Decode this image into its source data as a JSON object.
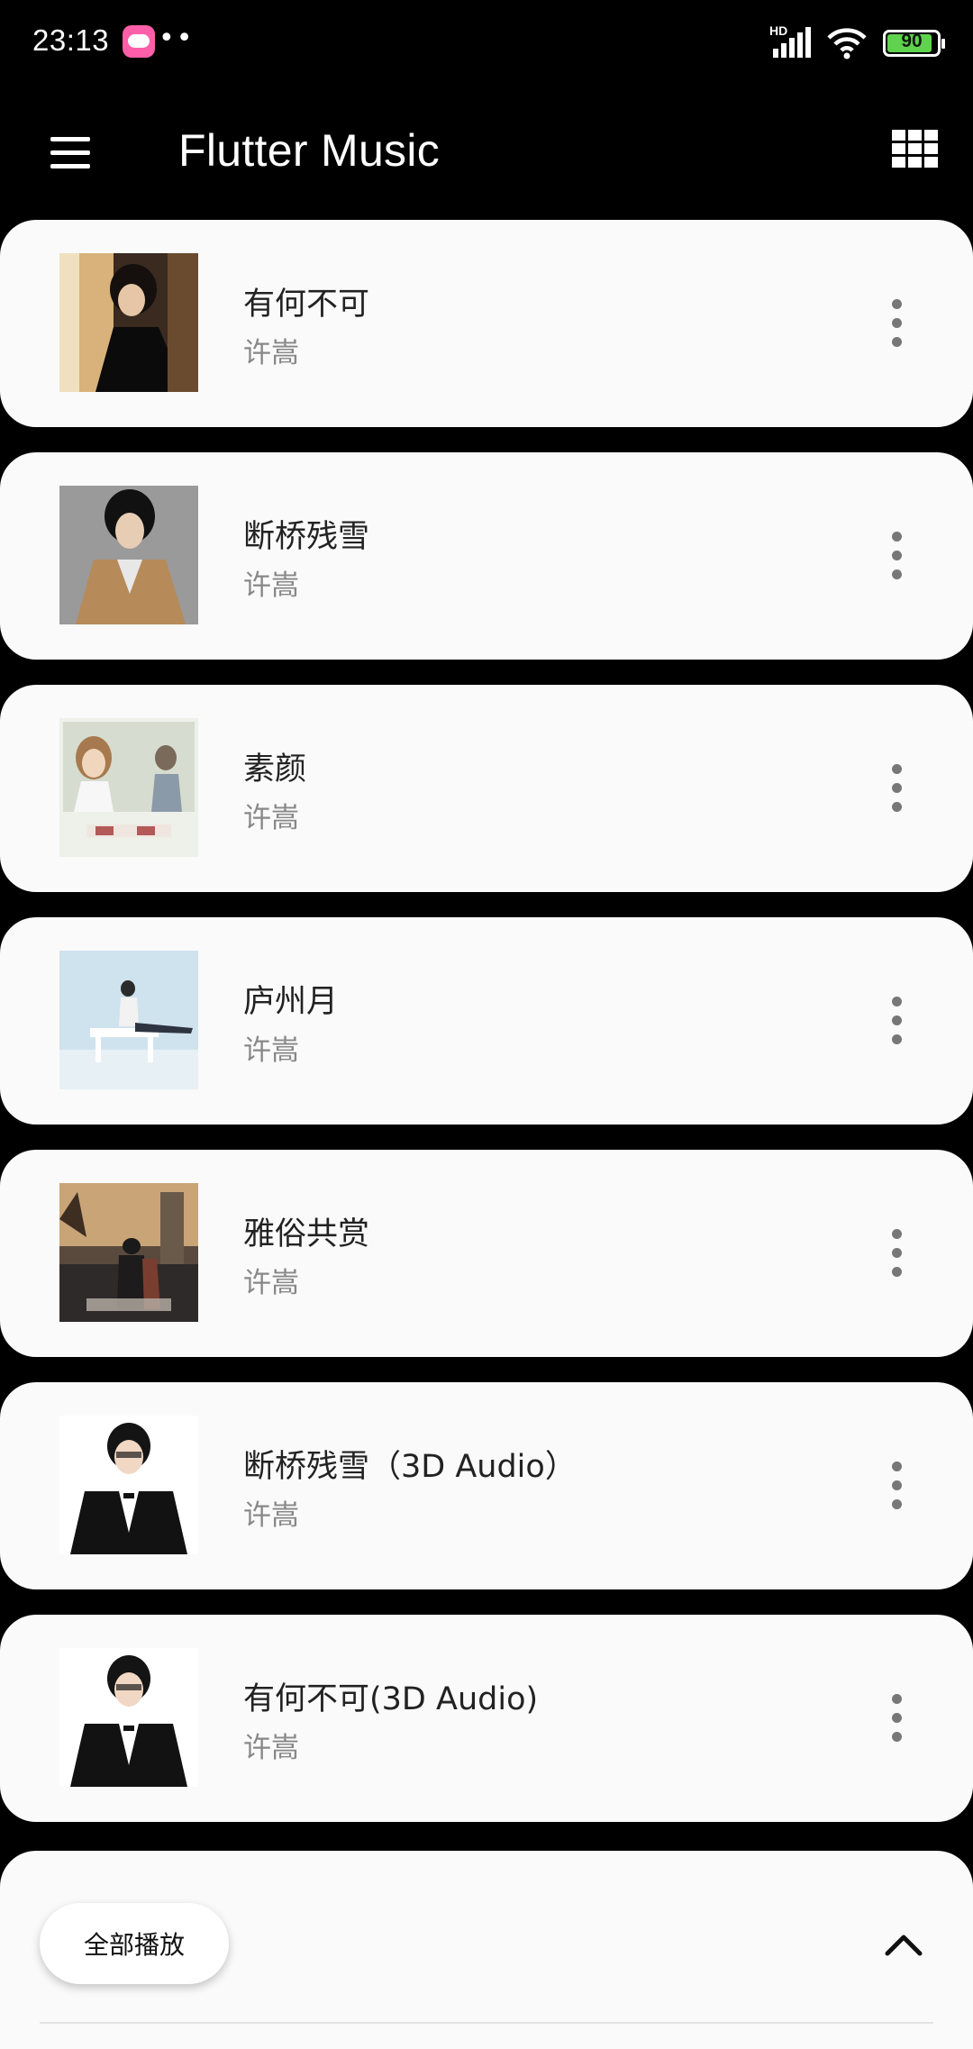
{
  "status_bar": {
    "time": "23:13",
    "app_icon": "hello-app-icon",
    "dots": "••",
    "network": "HD",
    "signal_icon": "signal-icon",
    "wifi_icon": "wifi-icon",
    "battery_level": "90",
    "battery_fraction": 0.9
  },
  "app_bar": {
    "title": "Flutter Music",
    "menu_icon": "hamburger-menu-icon",
    "view_icon": "grid-view-icon"
  },
  "songs": [
    {
      "title": "有何不可",
      "artist": "许嵩",
      "cover": "album-cover-zi-xu"
    },
    {
      "title": "断桥残雪",
      "artist": "许嵩",
      "cover": "album-cover-duan-qiao"
    },
    {
      "title": "素颜",
      "artist": "许嵩",
      "cover": "album-cover-su-yan"
    },
    {
      "title": "庐州月",
      "artist": "许嵩",
      "cover": "album-cover-lu-zhou-yue"
    },
    {
      "title": "雅俗共赏",
      "artist": "许嵩",
      "cover": "album-cover-qing-nian-wan-bao"
    },
    {
      "title": "断桥残雪（3D Audio）",
      "artist": "许嵩",
      "cover": "album-cover-3d-audio"
    },
    {
      "title": "有何不可(3D Audio)",
      "artist": "许嵩",
      "cover": "album-cover-3d-audio"
    }
  ],
  "bottom_sheet": {
    "play_all_label": "全部播放",
    "expand_icon": "chevron-up-icon"
  },
  "colors": {
    "background": "#000000",
    "card": "#fafafa",
    "battery_fill": "#5fd34d",
    "app_icon": "#ff5fa8"
  }
}
